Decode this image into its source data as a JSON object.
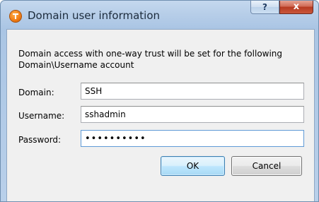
{
  "window": {
    "title": "Domain user information",
    "help_label": "?",
    "close_label": "x"
  },
  "message": "Domain access with one-way trust will be set for the following Domain\\Username account",
  "fields": {
    "domain": {
      "label": "Domain:",
      "value": "SSH"
    },
    "username": {
      "label": "Username:",
      "value": "sshadmin"
    },
    "password": {
      "label": "Password:",
      "value": "••••••••••"
    }
  },
  "buttons": {
    "ok_label": "OK",
    "cancel_label": "Cancel"
  },
  "colors": {
    "title_bar": "#b6cde8",
    "client_background": "#f0f0f0",
    "close_button": "#c9573b",
    "focus_border": "#5f9ad6",
    "app_icon": "#f07a10"
  },
  "icons": {
    "app": "app-logo-icon",
    "help": "help-icon",
    "close": "close-icon"
  }
}
